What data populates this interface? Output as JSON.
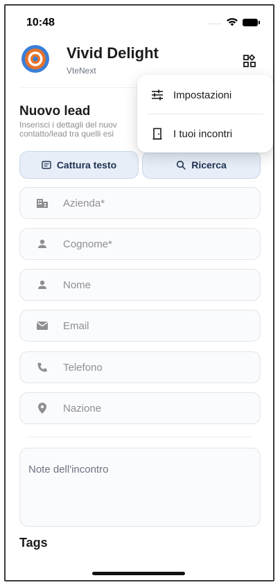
{
  "status_bar": {
    "time": "10:48",
    "signal": "....."
  },
  "header": {
    "title": "Vivid Delight",
    "subtitle": "VteNext"
  },
  "section": {
    "title": "Nuovo lead",
    "description": "Inserisci i dettagli del nuov\ncontatto/lead tra quelli esi"
  },
  "actions": {
    "capture_label": "Cattura testo",
    "search_label": "Ricerca"
  },
  "fields": {
    "company": "Azienda*",
    "surname": "Cognome*",
    "name": "Nome",
    "email": "Email",
    "phone": "Telefono",
    "country": "Nazione"
  },
  "notes": {
    "placeholder": "Note dell'incontro"
  },
  "tags": {
    "title": "Tags"
  },
  "menu": {
    "items": [
      {
        "label": "Impostazioni",
        "icon": "sliders-icon"
      },
      {
        "label": "I tuoi incontri",
        "icon": "door-icon"
      }
    ]
  },
  "colors": {
    "accent_orange": "#e8722a",
    "accent_blue": "#3b7fd6",
    "button_bg": "#e7eef7"
  }
}
